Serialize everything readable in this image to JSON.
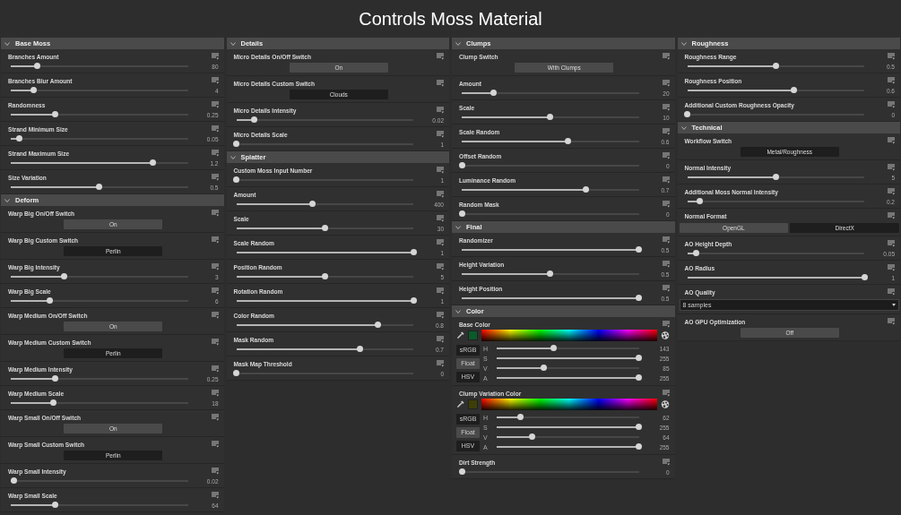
{
  "title": "Controls Moss Material",
  "columns": [
    {
      "sections": [
        {
          "title": "Base Moss",
          "expanded": true,
          "params": [
            {
              "kind": "slider",
              "label": "Branches Amount",
              "level": 0.15,
              "value": "80"
            },
            {
              "kind": "slider",
              "label": "Branches Blur Amount",
              "level": 0.13,
              "value": "4"
            },
            {
              "kind": "slider",
              "label": "Randomness",
              "level": 0.25,
              "value": "0.25"
            },
            {
              "kind": "slider",
              "label": "Strand Minimum Size",
              "level": 0.05,
              "value": "0.05"
            },
            {
              "kind": "slider",
              "label": "Strand Maximum Size",
              "level": 0.8,
              "value": "1.2"
            },
            {
              "kind": "slider",
              "label": "Size Variation",
              "level": 0.5,
              "value": "0.5"
            }
          ]
        },
        {
          "title": "Deform",
          "expanded": true,
          "params": [
            {
              "kind": "toggle",
              "label": "Warp Big On/Off Switch",
              "value": "On"
            },
            {
              "kind": "choice",
              "label": "Warp Big Custom Switch",
              "value": "Perlin"
            },
            {
              "kind": "slider",
              "label": "Warp Big Intensity",
              "level": 0.3,
              "value": "3"
            },
            {
              "kind": "slider",
              "label": "Warp Big Scale",
              "level": 0.22,
              "value": "6"
            },
            {
              "kind": "toggle",
              "label": "Warp Medium On/Off Switch",
              "value": "On"
            },
            {
              "kind": "choice",
              "label": "Warp Medium Custom Switch",
              "value": "Perlin"
            },
            {
              "kind": "slider",
              "label": "Warp Medium Intensity",
              "level": 0.25,
              "value": "0.25"
            },
            {
              "kind": "slider",
              "label": "Warp Medium Scale",
              "level": 0.24,
              "value": "18"
            },
            {
              "kind": "toggle",
              "label": "Warp Small On/Off Switch",
              "value": "On"
            },
            {
              "kind": "choice",
              "label": "Warp Small Custom Switch",
              "value": "Perlin"
            },
            {
              "kind": "slider",
              "label": "Warp Small Intensity",
              "level": 0.02,
              "value": "0.02"
            },
            {
              "kind": "slider",
              "label": "Warp Small Scale",
              "level": 0.25,
              "value": "64"
            }
          ]
        }
      ]
    },
    {
      "sections": [
        {
          "title": "Details",
          "expanded": true,
          "params": [
            {
              "kind": "toggle",
              "label": "Micro Details On/Off Switch",
              "value": "On"
            },
            {
              "kind": "choice",
              "label": "Micro Details Custom Switch",
              "value": "Clouds"
            },
            {
              "kind": "slider",
              "label": "Micro Details Intensity",
              "level": 0.1,
              "value": "0.02"
            },
            {
              "kind": "slider",
              "label": "Micro Details Scale",
              "level": 0,
              "value": "1"
            }
          ]
        },
        {
          "title": "Splatter",
          "expanded": true,
          "params": [
            {
              "kind": "slider",
              "label": "Custom Moss Input Number",
              "level": 0,
              "value": "1"
            },
            {
              "kind": "slider",
              "label": "Amount",
              "level": 0.43,
              "value": "400"
            },
            {
              "kind": "slider",
              "label": "Scale",
              "level": 0.5,
              "value": "30"
            },
            {
              "kind": "slider",
              "label": "Scale Random",
              "level": 1,
              "value": "1"
            },
            {
              "kind": "slider",
              "label": "Position Random",
              "level": 0.5,
              "value": "5"
            },
            {
              "kind": "slider",
              "label": "Rotation Random",
              "level": 1,
              "value": "1"
            },
            {
              "kind": "slider",
              "label": "Color Random",
              "level": 0.8,
              "value": "0.8"
            },
            {
              "kind": "slider",
              "label": "Mask Random",
              "level": 0.7,
              "value": "0.7"
            },
            {
              "kind": "slider",
              "label": "Mask Map Threshold",
              "level": 0,
              "value": "0"
            }
          ]
        }
      ]
    },
    {
      "sections": [
        {
          "title": "Clumps",
          "expanded": true,
          "params": [
            {
              "kind": "toggle",
              "label": "Clump Switch",
              "value": "With Clumps"
            },
            {
              "kind": "slider",
              "label": "Amount",
              "level": 0.18,
              "value": "20"
            },
            {
              "kind": "slider",
              "label": "Scale",
              "level": 0.5,
              "value": "10"
            },
            {
              "kind": "slider",
              "label": "Scale Random",
              "level": 0.6,
              "value": "0.6"
            },
            {
              "kind": "slider",
              "label": "Offset Random",
              "level": 0,
              "value": "0"
            },
            {
              "kind": "slider",
              "label": "Luminance Random",
              "level": 0.7,
              "value": "0.7"
            },
            {
              "kind": "slider",
              "label": "Random Mask",
              "level": 0,
              "value": "0"
            }
          ]
        },
        {
          "title": "Final",
          "expanded": true,
          "params": [
            {
              "kind": "slider",
              "label": "Randomizer",
              "level": 1,
              "value": "0.5"
            },
            {
              "kind": "slider",
              "label": "Height Variation",
              "level": 0.5,
              "value": "0.5"
            },
            {
              "kind": "slider",
              "label": "Height Position",
              "level": 1,
              "value": "0.5"
            }
          ]
        },
        {
          "title": "Color",
          "expanded": true,
          "params": [
            {
              "kind": "color",
              "label": "Base Color",
              "color": "#0b5a2a",
              "modes": [
                {
                  "label": "sRGB",
                  "selected": false
                },
                {
                  "label": "Float",
                  "selected": true
                },
                {
                  "label": "HSV",
                  "selected": false
                }
              ],
              "channels": [
                {
                  "letter": "H",
                  "level": 0.4,
                  "value": "143"
                },
                {
                  "letter": "S",
                  "level": 1,
                  "value": "255"
                },
                {
                  "letter": "V",
                  "level": 0.33,
                  "value": "85"
                },
                {
                  "letter": "A",
                  "level": 1,
                  "value": "255"
                }
              ]
            },
            {
              "kind": "color",
              "label": "Clump Variation Color",
              "color": "#3e3e08",
              "modes": [
                {
                  "label": "sRGB",
                  "selected": false
                },
                {
                  "label": "Float",
                  "selected": true
                },
                {
                  "label": "HSV",
                  "selected": false
                }
              ],
              "channels": [
                {
                  "letter": "H",
                  "level": 0.17,
                  "value": "62"
                },
                {
                  "letter": "S",
                  "level": 1,
                  "value": "255"
                },
                {
                  "letter": "V",
                  "level": 0.25,
                  "value": "64"
                },
                {
                  "letter": "A",
                  "level": 1,
                  "value": "255"
                }
              ]
            },
            {
              "kind": "slider",
              "label": "Dirt Strength",
              "level": 0,
              "value": "0"
            }
          ]
        }
      ]
    },
    {
      "sections": [
        {
          "title": "Roughness",
          "expanded": true,
          "params": [
            {
              "kind": "slider",
              "label": "Roughness Range",
              "level": 0.5,
              "value": "0.5"
            },
            {
              "kind": "slider",
              "label": "Roughness Position",
              "level": 0.6,
              "value": "0.6"
            },
            {
              "kind": "slider",
              "label": "Additional Custom Roughness Opacity",
              "level": 0,
              "value": "0"
            }
          ]
        },
        {
          "title": "Technical",
          "expanded": true,
          "params": [
            {
              "kind": "choice",
              "label": "Workflow Switch",
              "value": "Metal/Roughness"
            },
            {
              "kind": "slider",
              "label": "Normal Intensity",
              "level": 0.5,
              "value": "5"
            },
            {
              "kind": "slider",
              "label": "Additional Moss Normal Intensity",
              "level": 0.07,
              "value": "0.2"
            },
            {
              "kind": "segmented",
              "label": "Normal Format",
              "options": [
                {
                  "label": "OpenGL",
                  "selected": true
                },
                {
                  "label": "DirectX",
                  "selected": false
                }
              ]
            },
            {
              "kind": "slider",
              "label": "AO Height Depth",
              "level": 0.05,
              "value": "0.05"
            },
            {
              "kind": "slider",
              "label": "AO Radius",
              "level": 1,
              "value": "1"
            },
            {
              "kind": "dropdown",
              "label": "AO Quality",
              "value": "8 samples"
            },
            {
              "kind": "toggle",
              "label": "AO GPU Optimization",
              "value": "Off"
            }
          ]
        }
      ]
    }
  ]
}
